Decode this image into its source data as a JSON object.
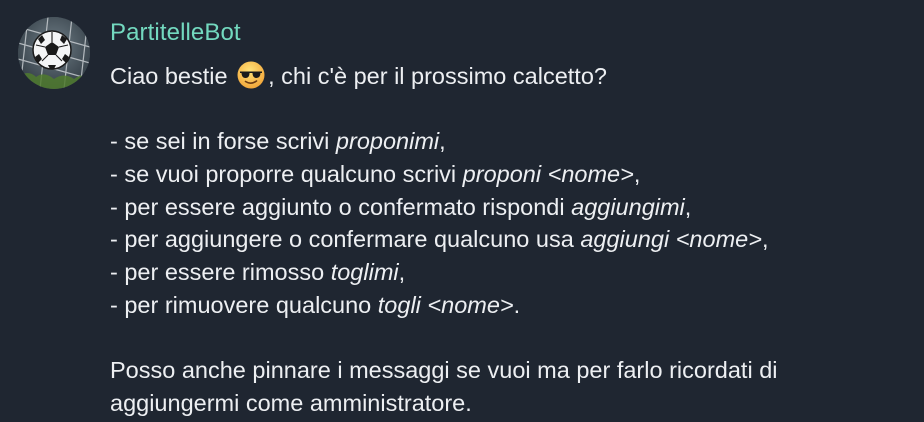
{
  "message": {
    "sender": "PartitelleBot",
    "avatar_icon": "soccer-ball-icon",
    "greeting_before": "Ciao bestie",
    "greeting_emoji_icon": "sunglasses-emoji-icon",
    "greeting_after": ", chi c'è per il prossimo calcetto?",
    "instructions": [
      {
        "prefix": "- se sei in forse scrivi ",
        "command": "proponimi",
        "suffix": ","
      },
      {
        "prefix": "- se vuoi proporre qualcuno scrivi ",
        "command": "proponi <nome>",
        "suffix": ","
      },
      {
        "prefix": "- per essere aggiunto o confermato rispondi ",
        "command": "aggiungimi",
        "suffix": ","
      },
      {
        "prefix": "- per aggiungere o confermare qualcuno usa ",
        "command": "aggiungi <nome>",
        "suffix": ","
      },
      {
        "prefix": "- per essere rimosso ",
        "command": "toglimi",
        "suffix": ","
      },
      {
        "prefix": "- per rimuovere qualcuno ",
        "command": "togli <nome>",
        "suffix": "."
      }
    ],
    "closing_line_1": "Posso anche pinnare i messaggi se vuoi ma per farlo ricordati di",
    "closing_line_2": "aggiungermi come amministratore."
  },
  "colors": {
    "background": "#1f2631",
    "sender_name": "#73d9bf",
    "text": "#edeff2"
  }
}
